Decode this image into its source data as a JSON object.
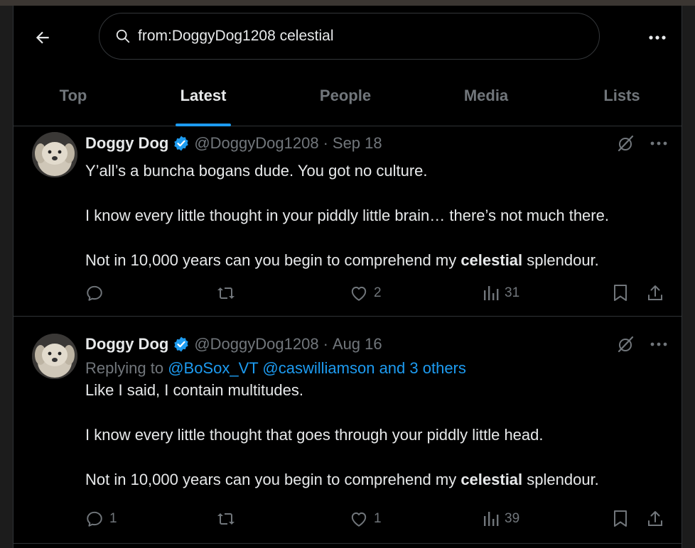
{
  "search": {
    "query": "from:DoggyDog1208 celestial"
  },
  "tabs": [
    {
      "label": "Top"
    },
    {
      "label": "Latest"
    },
    {
      "label": "People"
    },
    {
      "label": "Media"
    },
    {
      "label": "Lists"
    }
  ],
  "active_tab": "Latest",
  "tweets": [
    {
      "name": "Doggy Dog",
      "handle": "@DoggyDog1208",
      "separator": "·",
      "date": "Sep 18",
      "p1": "Y’all’s a buncha bogans dude. You got no culture.",
      "p2": "I know every little thought in your piddly little brain… there’s not much there.",
      "p3_pre": "Not in 10,000 years can you begin to comprehend my ",
      "p3_bold": "celestial",
      "p3_post": " splendour.",
      "replies": "",
      "retweets": "",
      "likes": "2",
      "views": "31"
    },
    {
      "name": "Doggy Dog",
      "handle": "@DoggyDog1208",
      "separator": "·",
      "date": "Aug 16",
      "reply_prefix": "Replying to ",
      "reply_user1": "@BoSox_VT",
      "reply_user2": "@caswilliamson and 3 others",
      "p1": "Like I said, I contain multitudes.",
      "p2": "I know every little thought that goes through your piddly little head.",
      "p3_pre": "Not in 10,000 years can you begin to comprehend my ",
      "p3_bold": "celestial",
      "p3_post": " splendour.",
      "replies": "1",
      "retweets": "",
      "likes": "1",
      "views": "39"
    }
  ],
  "colors": {
    "accent": "#1d9bf0",
    "muted": "#71767b",
    "text": "#e7e9ea",
    "background": "#000000"
  }
}
